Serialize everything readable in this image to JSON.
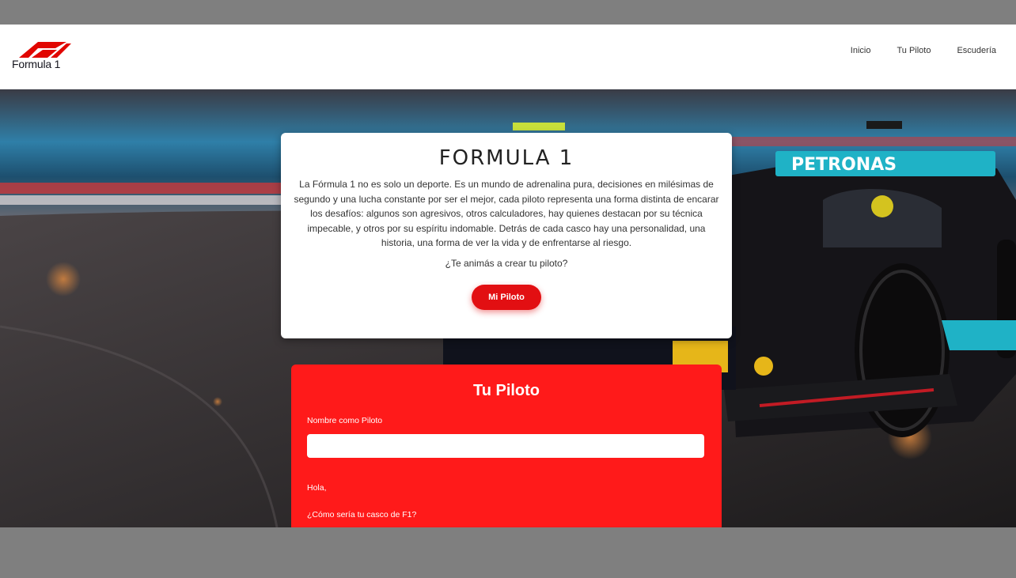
{
  "header": {
    "logo_text": "Formula 1",
    "nav": [
      "Inicio",
      "Tu Piloto",
      "Escudería"
    ]
  },
  "intro": {
    "title": "FORMULA 1",
    "description": "La Fórmula 1 no es solo un deporte. Es un mundo de adrenalina pura, decisiones en milésimas de segundo y una lucha constante por ser el mejor, cada piloto representa una forma distinta de encarar los desafíos: algunos son agresivos, otros calculadores, hay quienes destacan por su técnica impecable, y otros por su espíritu indomable. Detrás de cada casco hay una personalidad, una historia, una forma de ver la vida y de enfrentarse al riesgo.",
    "question": "¿Te animás a crear tu piloto?",
    "button_label": "Mi Piloto"
  },
  "form": {
    "title": "Tu Piloto",
    "name_label": "Nombre como Piloto",
    "name_value": "",
    "greeting": "Hola,",
    "helmet_question": "¿Cómo sería tu casco de F1?"
  },
  "colors": {
    "brand_red": "#e20f12",
    "form_red": "#ff1a1a"
  }
}
